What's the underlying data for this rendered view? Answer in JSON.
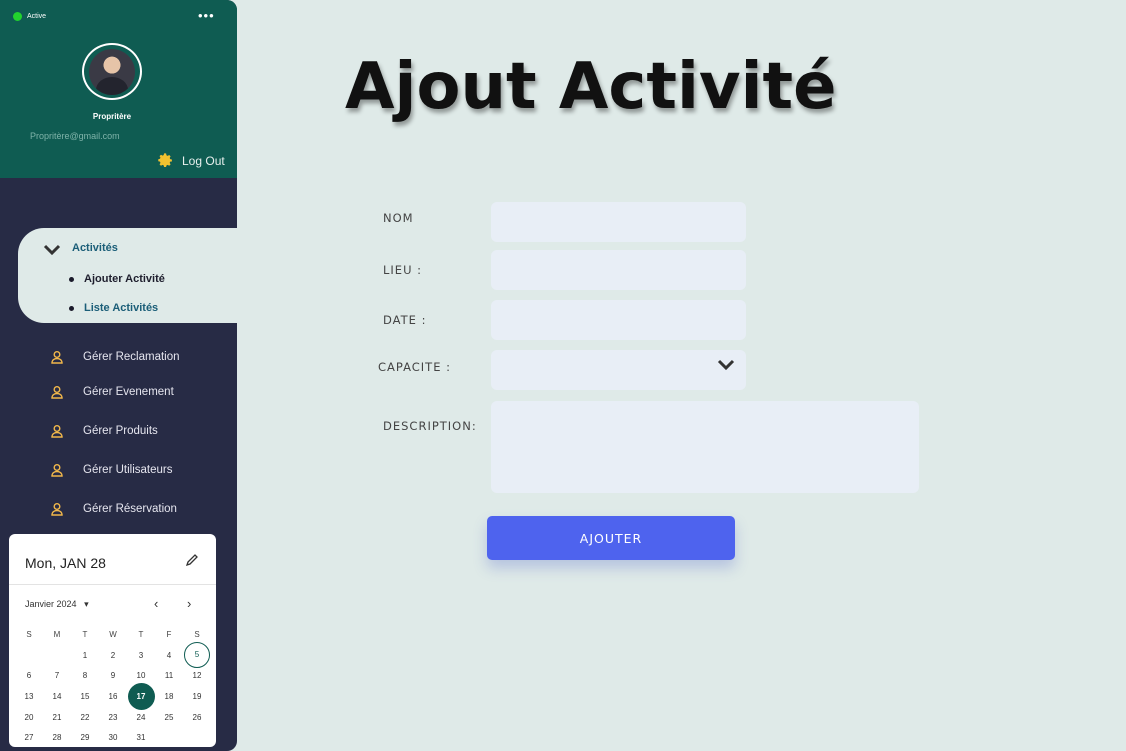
{
  "sidebar": {
    "status": "Active",
    "more": "•••",
    "profile_name": "Propritère",
    "profile_email": "Propritère@gmail.com",
    "logout_label": "Log Out",
    "active_menu": {
      "title": "Activités",
      "items": [
        "Ajouter Activité",
        "Liste Activités"
      ]
    },
    "nav_items": [
      "Gérer Reclamation",
      "Gérer Evenement",
      "Gérer Produits",
      "Gérer Utilisateurs",
      "Gérer Réservation"
    ]
  },
  "calendar": {
    "selected_date": "Mon, JAN 28",
    "month_label": "Janvier 2024",
    "weekdays": [
      "S",
      "M",
      "T",
      "W",
      "T",
      "F",
      "S"
    ],
    "weeks": [
      [
        "",
        "",
        "1",
        "2",
        "3",
        "4",
        "5"
      ],
      [
        "6",
        "7",
        "8",
        "9",
        "10",
        "11",
        "12"
      ],
      [
        "13",
        "14",
        "15",
        "16",
        "17",
        "18",
        "19"
      ],
      [
        "20",
        "21",
        "22",
        "23",
        "24",
        "25",
        "26"
      ],
      [
        "27",
        "28",
        "29",
        "30",
        "31",
        "",
        ""
      ]
    ],
    "highlighted_day": "17",
    "outlined_day": "5"
  },
  "main": {
    "title": "Ajout Activité",
    "labels": {
      "nom": "NOM",
      "lieu": "LIEU :",
      "date": "DATE :",
      "capacite": "CAPACITE :",
      "description": "DESCRIPTION:"
    },
    "submit_label": "AJOUTER"
  },
  "colors": {
    "sidebar_bg": "#272b45",
    "profile_bg": "#0f5c52",
    "accent_button": "#4e63ee",
    "page_bg": "#dfeae8"
  }
}
